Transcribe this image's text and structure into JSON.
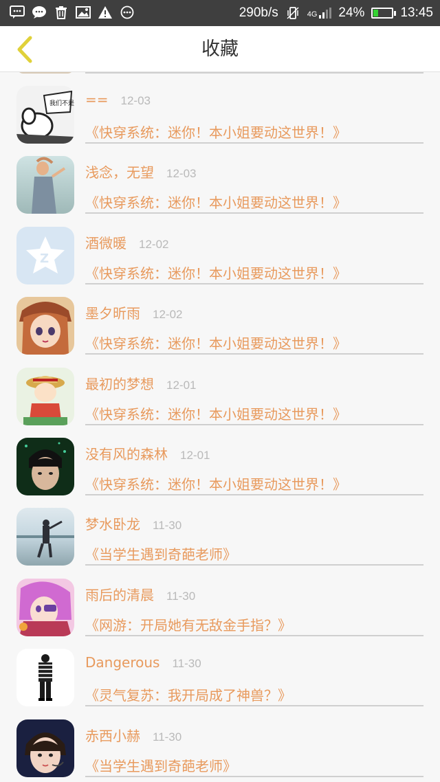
{
  "status_bar": {
    "network_speed": "290b/s",
    "network_type": "4G",
    "battery_percent": "24%",
    "battery_level": 0.24,
    "time": "13:45",
    "icons": [
      "message-icon",
      "chat-bubble-icon",
      "trash-icon",
      "image-icon",
      "warning-icon",
      "more-dots-icon",
      "vibrate-icon",
      "signal-icon",
      "battery-icon"
    ]
  },
  "header": {
    "title": "收藏",
    "back_icon": "chevron-left-icon",
    "accent_color": "#e0d13a"
  },
  "favorites": [
    {
      "user": "==",
      "date": "12-03",
      "book": "《快穿系统：迷你！本小姐要动这世界！》",
      "avatar_icon": "comic-avatar"
    },
    {
      "user": "浅念，无望",
      "date": "12-03",
      "book": "《快穿系统：迷你！本小姐要动这世界！》",
      "avatar_icon": "photo-avatar"
    },
    {
      "user": "酒微暖",
      "date": "12-02",
      "book": "《快穿系统：迷你！本小姐要动这世界！》",
      "avatar_icon": "default-qq-avatar"
    },
    {
      "user": "墨夕昕雨",
      "date": "12-02",
      "book": "《快穿系统：迷你！本小姐要动这世界！》",
      "avatar_icon": "anime-avatar"
    },
    {
      "user": "最初的梦想",
      "date": "12-01",
      "book": "《快穿系统：迷你！本小姐要动这世界！》",
      "avatar_icon": "cartoon-avatar"
    },
    {
      "user": "没有风的森林",
      "date": "12-01",
      "book": "《快穿系统：迷你！本小姐要动这世界！》",
      "avatar_icon": "portrait-avatar"
    },
    {
      "user": "梦水卧龙",
      "date": "11-30",
      "book": "《当学生遇到奇葩老师》",
      "avatar_icon": "beach-avatar"
    },
    {
      "user": "雨后的清晨",
      "date": "11-30",
      "book": "《网游：开局她有无敌金手指？》",
      "avatar_icon": "anime-pink-avatar"
    },
    {
      "user": "Dangerous",
      "date": "11-30",
      "book": "《灵气复苏：我开局成了神兽？》",
      "avatar_icon": "figure-avatar"
    },
    {
      "user": "赤西小赫",
      "date": "11-30",
      "book": "《当学生遇到奇葩老师》",
      "avatar_icon": "portrait-avatar-2"
    }
  ],
  "colors": {
    "name": "#e89a5d",
    "date": "#b9b9b9",
    "status_bar": "#3f3f3f",
    "battery": "#35d233"
  }
}
